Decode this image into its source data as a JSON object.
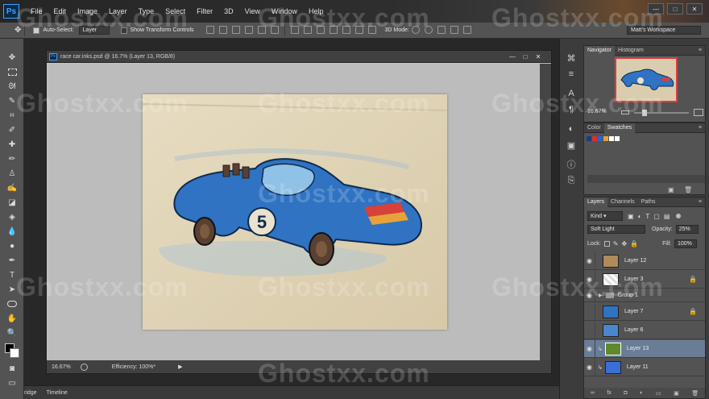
{
  "app": {
    "logo": "Ps",
    "menu": [
      "File",
      "Edit",
      "Image",
      "Layer",
      "Type",
      "Select",
      "Filter",
      "3D",
      "View",
      "Window",
      "Help"
    ],
    "window_controls": [
      "—",
      "□",
      "✕"
    ]
  },
  "options_bar": {
    "auto_select_label": "Auto-Select:",
    "auto_select_value": "Layer",
    "transform_label": "Show Transform Controls",
    "mode_3d_label": "3D Mode:",
    "workspace": "Matt's Workspace"
  },
  "tools": [
    "move-icon",
    "marquee-icon",
    "lasso-icon",
    "quick-select-icon",
    "crop-icon",
    "eyedropper-icon",
    "healing-icon",
    "brush-icon",
    "stamp-icon",
    "history-brush-icon",
    "eraser-icon",
    "paint-bucket-icon",
    "blur-icon",
    "dodge-icon",
    "pen-icon",
    "type-icon",
    "path-select-icon",
    "shape-icon",
    "hand-icon",
    "zoom-icon"
  ],
  "document": {
    "title": "race car.inks.psd @ 16.7% (Layer 13, RGB/8)",
    "zoom": "16.67%",
    "efficiency": "Efficiency: 100%*"
  },
  "bottom_tabs": [
    "ridge",
    "Timeline"
  ],
  "navigator": {
    "tabs": [
      "Navigator",
      "Histogram"
    ],
    "zoom": "16.67%"
  },
  "swatches": {
    "tabs": [
      "Color",
      "Swatches"
    ],
    "colors": [
      "#1a3a8a",
      "#d83030",
      "#2a66c9",
      "#e8a23a",
      "#ffffff",
      "#ffffff"
    ]
  },
  "layers": {
    "tabs": [
      "Layers",
      "Channels",
      "Paths"
    ],
    "kind": "Kind",
    "blend_mode": "Soft Light",
    "opacity_label": "Opacity:",
    "opacity": "25%",
    "lock_label": "Lock:",
    "fill_label": "Fill:",
    "fill": "100%",
    "items": [
      {
        "name": "Layer 12",
        "visible": true,
        "locked": false,
        "selected": false,
        "thumb": "paper"
      },
      {
        "name": "Layer 3",
        "visible": true,
        "locked": true,
        "selected": false,
        "thumb": "transparent"
      },
      {
        "name": "Group 1",
        "visible": true,
        "locked": false,
        "selected": false,
        "thumb": "folder"
      },
      {
        "name": "Layer 7",
        "visible": false,
        "locked": true,
        "selected": false,
        "thumb": "blue"
      },
      {
        "name": "Layer 6",
        "visible": false,
        "locked": false,
        "selected": false,
        "thumb": "blue"
      },
      {
        "name": "Layer 13",
        "visible": true,
        "locked": false,
        "selected": true,
        "thumb": "green"
      },
      {
        "name": "Layer 11",
        "visible": true,
        "locked": false,
        "selected": false,
        "thumb": "blue"
      }
    ],
    "footer_icons": [
      "link-icon",
      "fx-icon",
      "mask-icon",
      "adjustment-icon",
      "folder-icon",
      "new-layer-icon",
      "trash-icon"
    ]
  },
  "watermark": "Ghostxx.com"
}
